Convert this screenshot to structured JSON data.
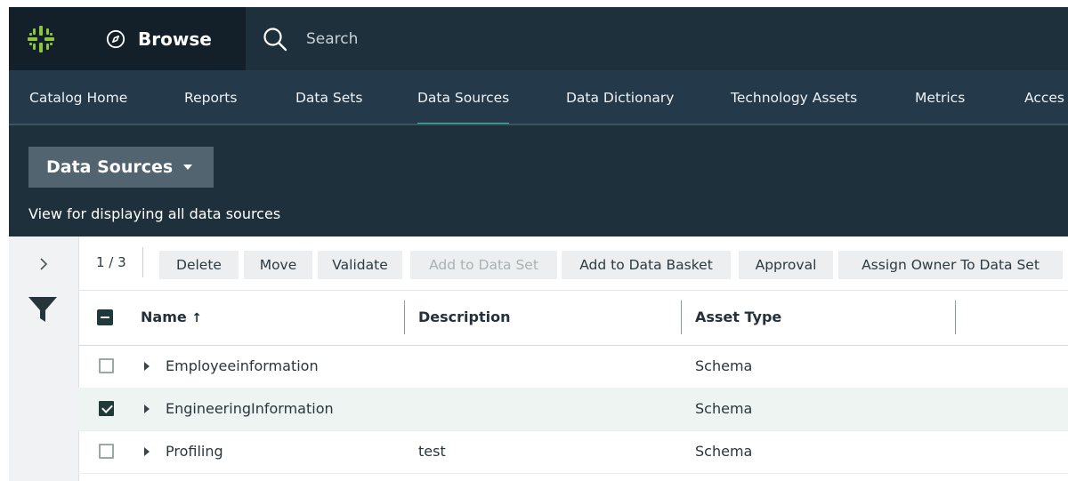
{
  "topbar": {
    "browse_label": "Browse",
    "search_placeholder": "Search"
  },
  "nav": {
    "items": [
      "Catalog Home",
      "Reports",
      "Data Sets",
      "Data Sources",
      "Data Dictionary",
      "Technology Assets",
      "Metrics",
      "Acces"
    ],
    "active": "Data Sources"
  },
  "header": {
    "view_title": "Data Sources",
    "view_description": "View for displaying all data sources"
  },
  "toolbar": {
    "pager": "1 / 3",
    "buttons": [
      "Delete",
      "Move",
      "Validate",
      "Add to Data Set",
      "Add to Data Basket",
      "Approval",
      "Assign Owner To Data Set"
    ],
    "disabled": [
      "Add to Data Set"
    ]
  },
  "table": {
    "columns": [
      "Name",
      "Description",
      "Asset Type"
    ],
    "sort_indicator": "↑",
    "rows": [
      {
        "name": "Employeeinformation",
        "description": "",
        "asset_type": "Schema",
        "checked": false
      },
      {
        "name": "EngineeringInformation",
        "description": "",
        "asset_type": "Schema",
        "checked": true
      },
      {
        "name": "Profiling",
        "description": "test",
        "asset_type": "Schema",
        "checked": false
      }
    ]
  },
  "colors": {
    "topbar": "#1e303b",
    "nav": "#24394a",
    "accent": "#3fbfa6",
    "logo_green": "#8cc63f"
  },
  "icons": [
    "logo-icon",
    "compass-icon",
    "search-icon",
    "chevron-right-icon",
    "filter-icon",
    "caret-down-icon",
    "expand-row-icon"
  ]
}
